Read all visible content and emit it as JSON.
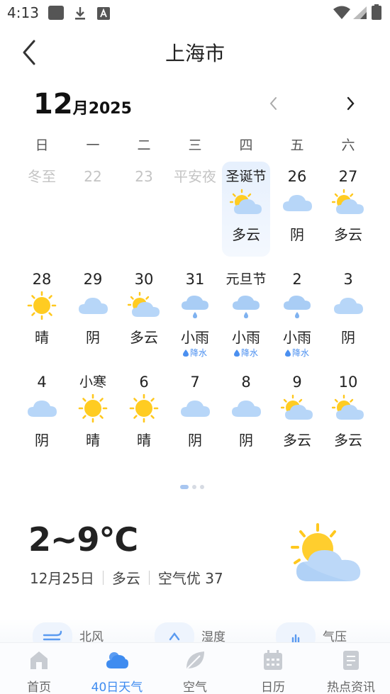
{
  "status_bar": {
    "time": "4:13",
    "icons": [
      "square-notification-icon",
      "download-icon",
      "a-icon",
      "wifi-icon",
      "cellular-icon",
      "battery-icon"
    ]
  },
  "header": {
    "title": "上海市",
    "back_icon": "chevron-left-icon"
  },
  "calendar_header": {
    "month": "12",
    "month_unit": "月",
    "year": "2025"
  },
  "weekdays": [
    "日",
    "一",
    "二",
    "三",
    "四",
    "五",
    "六"
  ],
  "rows": [
    [
      {
        "day": "冬至",
        "past": true
      },
      {
        "day": "22",
        "past": true
      },
      {
        "day": "23",
        "past": true
      },
      {
        "day": "平安夜",
        "past": true
      },
      {
        "day": "圣诞节",
        "icon": "partly-cloudy",
        "desc": "多云",
        "selected": true
      },
      {
        "day": "26",
        "icon": "cloudy",
        "desc": "阴"
      },
      {
        "day": "27",
        "icon": "partly-cloudy",
        "desc": "多云"
      }
    ],
    [
      {
        "day": "28",
        "icon": "sunny",
        "desc": "晴"
      },
      {
        "day": "29",
        "icon": "cloudy",
        "desc": "阴"
      },
      {
        "day": "30",
        "icon": "partly-cloudy",
        "desc": "多云"
      },
      {
        "day": "31",
        "icon": "rain",
        "desc": "小雨",
        "precip": "降水"
      },
      {
        "day": "元旦节",
        "icon": "rain",
        "desc": "小雨",
        "precip": "降水"
      },
      {
        "day": "2",
        "icon": "rain",
        "desc": "小雨",
        "precip": "降水"
      },
      {
        "day": "3",
        "icon": "cloudy",
        "desc": "阴"
      }
    ],
    [
      {
        "day": "4",
        "icon": "cloudy",
        "desc": "阴"
      },
      {
        "day": "小寒",
        "icon": "sunny",
        "desc": "晴"
      },
      {
        "day": "6",
        "icon": "sunny",
        "desc": "晴"
      },
      {
        "day": "7",
        "icon": "cloudy",
        "desc": "阴"
      },
      {
        "day": "8",
        "icon": "cloudy",
        "desc": "阴"
      },
      {
        "day": "9",
        "icon": "partly-cloudy",
        "desc": "多云"
      },
      {
        "day": "10",
        "icon": "partly-cloudy",
        "desc": "多云"
      }
    ]
  ],
  "pager": {
    "count": 3,
    "active": 0
  },
  "today": {
    "temp": "2~9℃",
    "date": "12月25日",
    "weather": "多云",
    "aqi": "空气优 37",
    "icon": "partly-cloudy"
  },
  "details": [
    {
      "label": "北风",
      "icon": "wind-icon"
    },
    {
      "label": "湿度",
      "icon": "humidity-icon"
    },
    {
      "label": "气压",
      "icon": "pressure-icon"
    }
  ],
  "bottom_nav": [
    {
      "label": "首页",
      "icon": "home-icon",
      "active": false
    },
    {
      "label": "40日天气",
      "icon": "weather-cloud-icon",
      "active": true
    },
    {
      "label": "空气",
      "icon": "leaf-icon",
      "active": false
    },
    {
      "label": "日历",
      "icon": "calendar-icon",
      "active": false
    },
    {
      "label": "热点资讯",
      "icon": "news-icon",
      "active": false
    }
  ],
  "colors": {
    "accent": "#3f8cf0",
    "sun": "#ffc81e",
    "cloud": "#a9cdf5",
    "selected_bg": "#e6f0fd",
    "past_text": "#c4c4c4"
  }
}
